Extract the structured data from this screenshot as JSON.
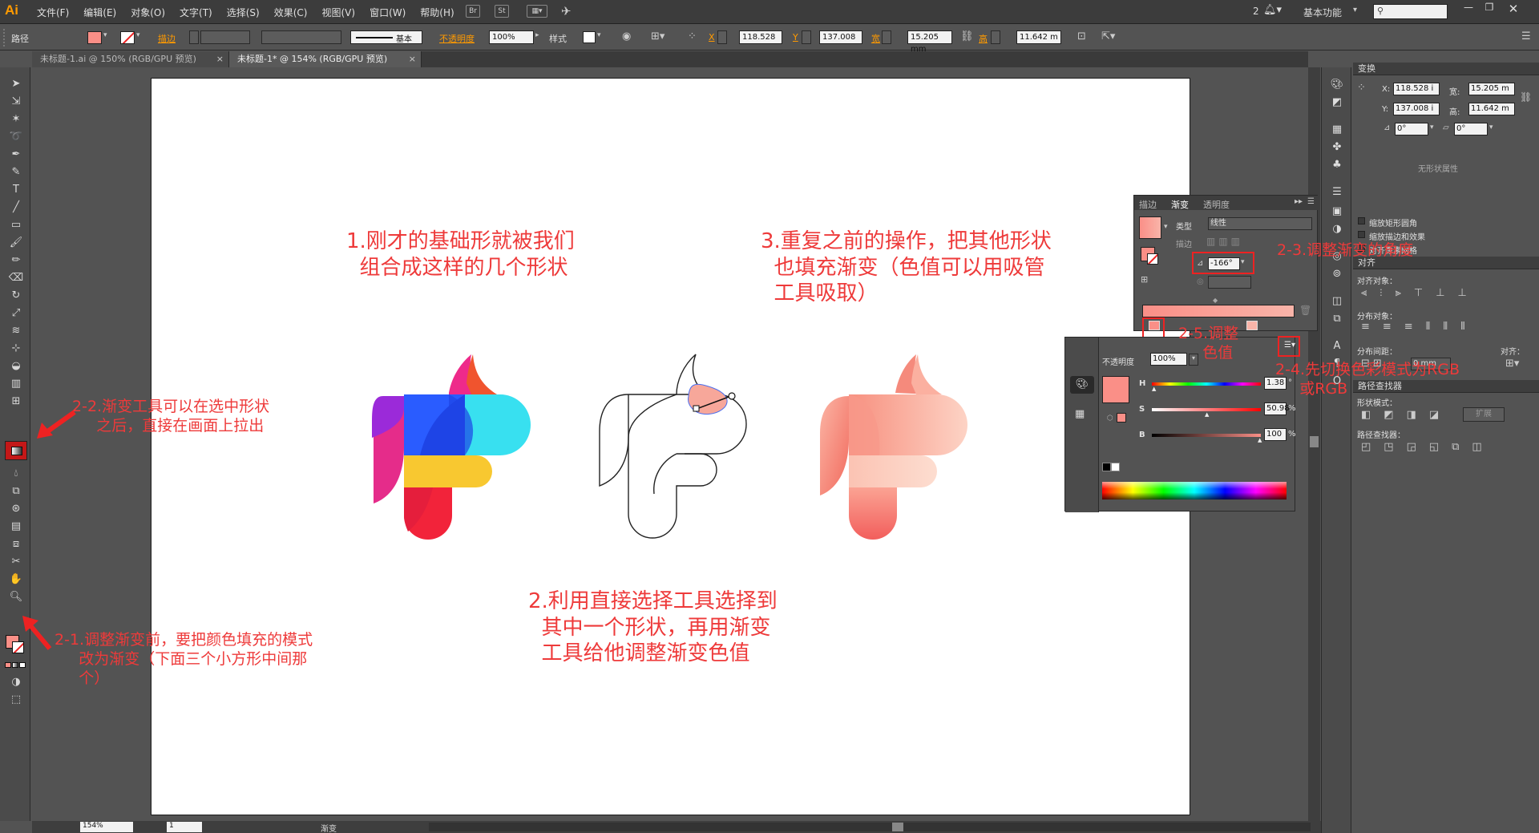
{
  "app": {
    "logo": "Ai"
  },
  "menu": [
    "文件(F)",
    "编辑(E)",
    "对象(O)",
    "文字(T)",
    "选择(S)",
    "效果(C)",
    "视图(V)",
    "窗口(W)",
    "帮助(H)"
  ],
  "menubar_right": {
    "badge_count": "2",
    "workspace": "基本功能"
  },
  "control": {
    "selection_type": "路径",
    "stroke_label": "描边",
    "stroke_profile": "基本",
    "opacity_label": "不透明度",
    "opacity_value": "100%",
    "style_label": "样式",
    "x_label": "X",
    "x_value": "118.528",
    "y_label": "Y",
    "y_value": "137.008",
    "w_label": "宽",
    "w_value": "15.205 mm",
    "h_label": "高",
    "h_value": "11.642 m"
  },
  "tabs": [
    {
      "label": "未标题-1.ai @ 150% (RGB/GPU 预览)",
      "close": "×"
    },
    {
      "label": "未标题-1* @ 154% (RGB/GPU 预览)",
      "close": "×"
    }
  ],
  "annotations": {
    "step1": "1.刚才的基础形就被我们\n  组合成这样的几个形状",
    "step2": "2.利用直接选择工具选择到\n  其中一个形状，再用渐变\n  工具给他调整渐变色值",
    "step3": "3.重复之前的操作，把其他形状\n  也填充渐变（色值可以用吸管\n  工具吸取）",
    "step2_1": "2-1.调整渐变前，要把颜色填充的模式\n     改为渐变（下面三个小方形中间那\n     个）",
    "step2_2": "2-2.渐变工具可以在选中形状\n     之后，直接在画面上拉出",
    "step2_3": "2-3.调整渐变的角度",
    "step2_4": "2-4.先切换色彩模式为RGB\n     或RGB",
    "step2_5": "2-5.调整\n     色值"
  },
  "gradient_panel": {
    "tabs": [
      "描边",
      "渐变",
      "透明度"
    ],
    "type_label": "类型",
    "type_value": "线性",
    "stroke_label": "描边",
    "angle_value": "-166°"
  },
  "color_panel": {
    "opacity_label": "不透明度",
    "opacity_value": "100%",
    "h_label": "H",
    "h_value": "1.38",
    "h_unit": "°",
    "s_label": "S",
    "s_value": "50.98",
    "s_unit": "%",
    "b_label": "B",
    "b_value": "100",
    "b_unit": "%"
  },
  "transform_panel": {
    "title": "变换",
    "x_label": "X:",
    "x_value": "118.528 i",
    "y_label": "Y:",
    "y_value": "137.008 i",
    "w_label": "宽:",
    "w_value": "15.205 m",
    "h_label": "高:",
    "h_value": "11.642 m",
    "angle1": "0°",
    "angle2": "0°",
    "no_shape": "无形状属性",
    "opt1": "缩放矩形圆角",
    "opt2": "缩放描边和效果",
    "opt3": "对齐像素网格"
  },
  "align_panel": {
    "title": "对齐",
    "align_objects": "对齐对象：",
    "distribute_objects": "分布对象：",
    "distribute_spacing": "分布间距：",
    "align_to": "对齐：",
    "spacing_value": "0 mm"
  },
  "pathfinder_panel": {
    "title": "路径查找器",
    "shape_modes": "形状模式：",
    "expand": "扩展",
    "pathfinders": "路径查找器："
  },
  "status": {
    "zoom": "154%",
    "page": "1",
    "tool": "渐变"
  },
  "colors": {
    "annotation_red": "#ee3a3a",
    "fill_salmon": "#fa8f87",
    "menubar": "#3c3c3c",
    "panel": "#535353"
  }
}
